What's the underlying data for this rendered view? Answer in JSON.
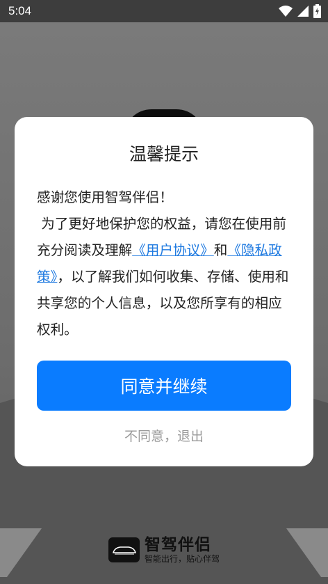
{
  "status_bar": {
    "time": "5:04",
    "icons": [
      "wifi-icon",
      "cell-signal-icon",
      "battery-icon"
    ]
  },
  "dialog": {
    "title": "温馨提示",
    "greeting": "感谢您使用智驾伴侣！",
    "text_before_links": " 为了更好地保护您的权益，请您在使用前充分阅读及理解",
    "user_agreement_link": "《用户协议》",
    "conjunction": "和",
    "privacy_policy_link": "《隐私政策》",
    "text_after_links": "，以了解我们如何收集、存储、使用和共享您的个人信息，以及您所享有的相应权利。",
    "agree_button": "同意并继续",
    "disagree_button": "不同意，退出"
  },
  "brand": {
    "name": "智驾伴侣",
    "slogan": "智能出行，贴心伴驾"
  },
  "colors": {
    "primary": "#0a7cff",
    "link": "#1f7ae0",
    "muted": "#9b9b9b"
  }
}
